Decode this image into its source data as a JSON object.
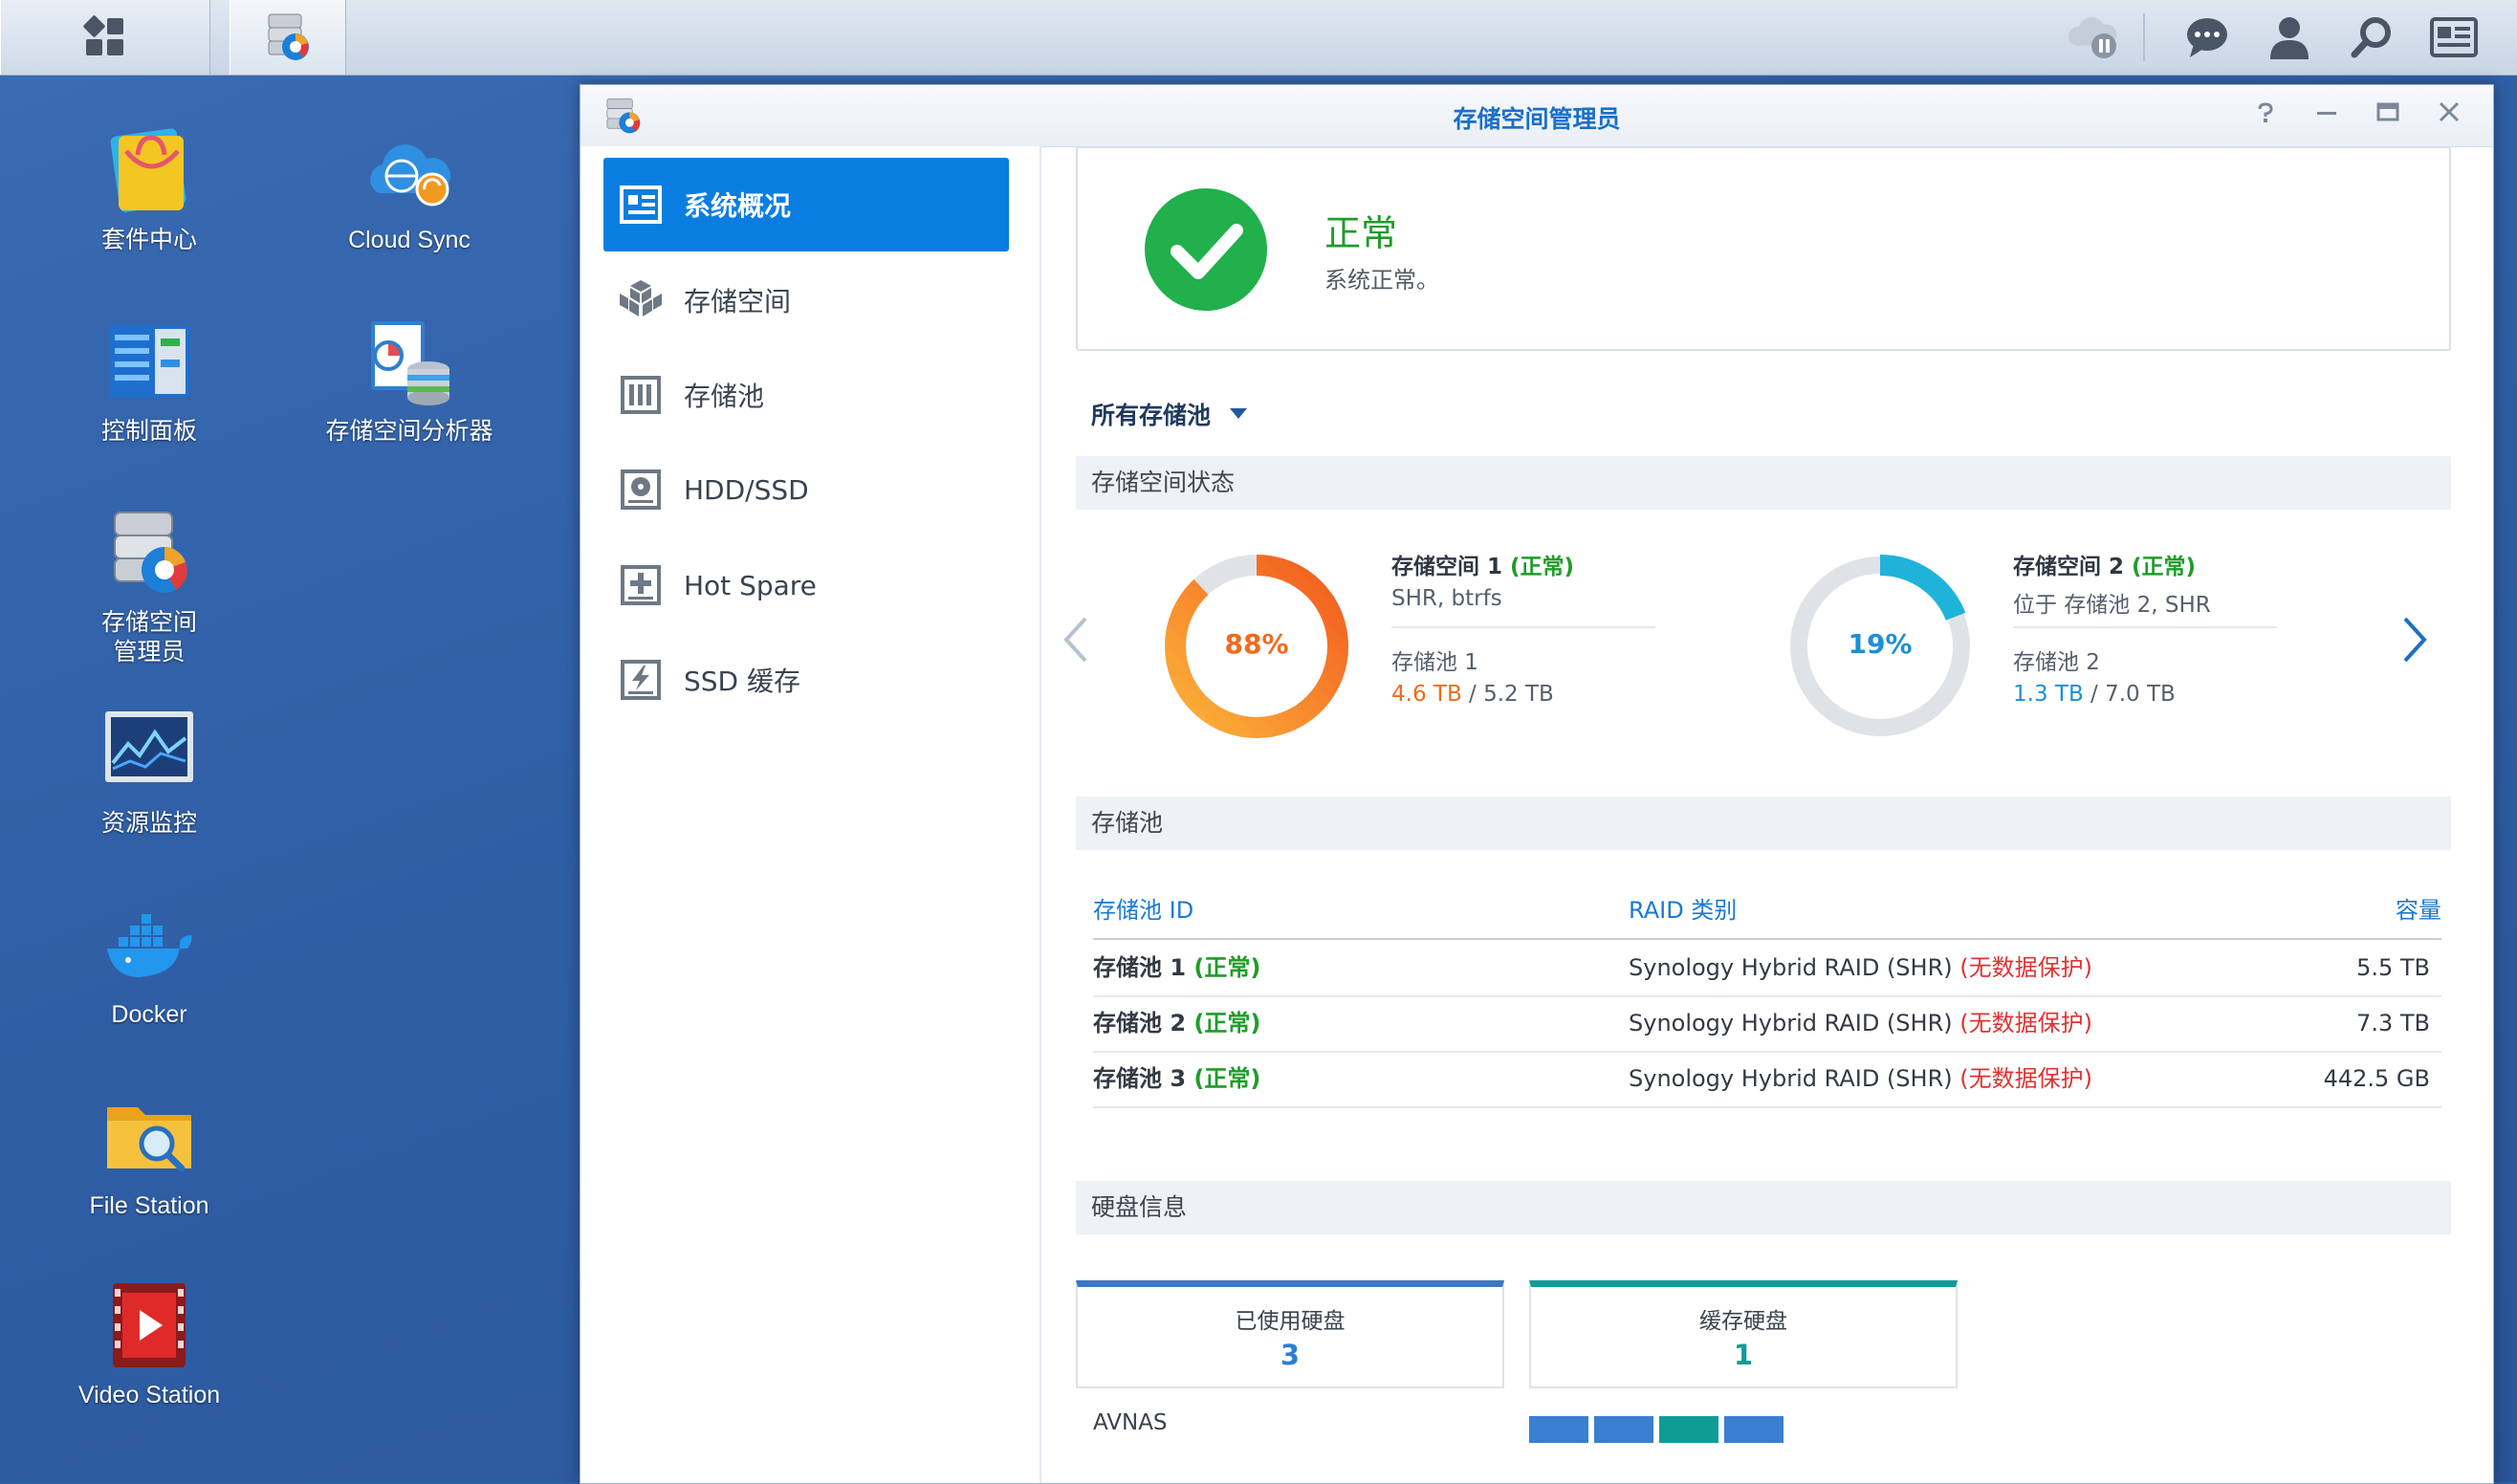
{
  "desktop": {
    "icons": [
      {
        "label": "套件中心"
      },
      {
        "label": "Cloud Sync"
      },
      {
        "label": "控制面板"
      },
      {
        "label": "存储空间分析器"
      },
      {
        "label_line1": "存储空间",
        "label_line2": "管理员"
      },
      {
        "label": "资源监控"
      },
      {
        "label": "Docker"
      },
      {
        "label": "File Station"
      },
      {
        "label": "Video Station"
      }
    ]
  },
  "taskbar": {
    "main_menu_icon": "grid-icon",
    "running_app_icon": "storage-manager-icon",
    "right_icons": [
      "cloud-pause-icon",
      "chat-icon",
      "user-icon",
      "search-icon",
      "widgets-icon"
    ]
  },
  "window": {
    "title": "存储空间管理员",
    "controls": [
      "help",
      "minimize",
      "maximize",
      "close"
    ]
  },
  "sidebar": {
    "items": [
      {
        "label": "系统概况",
        "icon": "overview-icon"
      },
      {
        "label": "存储空间",
        "icon": "cubes-icon"
      },
      {
        "label": "存储池",
        "icon": "pool-icon"
      },
      {
        "label": "HDD/SSD",
        "icon": "disk-icon"
      },
      {
        "label": "Hot Spare",
        "icon": "hotspare-icon"
      },
      {
        "label": "SSD 缓存",
        "icon": "ssd-cache-icon"
      }
    ]
  },
  "status": {
    "title": "正常",
    "description": "系统正常。"
  },
  "filter": {
    "label": "所有存储池"
  },
  "volume_section": {
    "heading": "存储空间状态",
    "volumes": [
      {
        "percent_label": "88%",
        "used_fraction": 0.88,
        "name": "存储空间 1",
        "status": "正常",
        "detail": "SHR, btrfs",
        "pool": "存储池 1",
        "used": "4.6 TB",
        "total": "/ 5.2 TB",
        "color": "#f26a1b"
      },
      {
        "percent_label": "19%",
        "used_fraction": 0.19,
        "name": "存储空间 2",
        "status": "正常",
        "detail": "位于 存储池 2, SHR",
        "pool": "存储池 2",
        "used": "1.3 TB",
        "total": "/ 7.0 TB",
        "color": "#1fb3d9"
      }
    ]
  },
  "pool_section": {
    "heading": "存储池",
    "columns": [
      "存储池 ID",
      "RAID 类别",
      "容量"
    ],
    "rows": [
      {
        "name": "存储池 1",
        "status": "正常",
        "raid": "Synology Hybrid RAID (SHR)",
        "warning": "(无数据保护)",
        "capacity": "5.5 TB"
      },
      {
        "name": "存储池 2",
        "status": "正常",
        "raid": "Synology Hybrid RAID (SHR)",
        "warning": "(无数据保护)",
        "capacity": "7.3 TB"
      },
      {
        "name": "存储池 3",
        "status": "正常",
        "raid": "Synology Hybrid RAID (SHR)",
        "warning": "(无数据保护)",
        "capacity": "442.5 GB"
      }
    ]
  },
  "disk_section": {
    "heading": "硬盘信息",
    "cards": [
      {
        "label": "已使用硬盘",
        "value": "3",
        "color": "#3a78c6"
      },
      {
        "label": "缓存硬盘",
        "value": "1",
        "color": "#0f9c94"
      }
    ],
    "host": "AVNAS",
    "slot_colors": [
      "#3a7fd0",
      "#3a7fd0",
      "#0f9c94",
      "#3a7fd0"
    ]
  }
}
